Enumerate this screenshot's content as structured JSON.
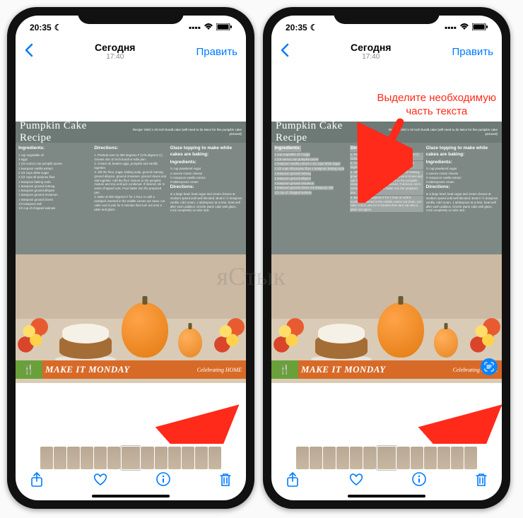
{
  "status": {
    "time": "20:35",
    "moon": "☾"
  },
  "nav": {
    "title": "Сегодня",
    "subtitle": "17:40",
    "edit": "Править"
  },
  "recipe": {
    "title": "Pumpkin Cake Recipe",
    "yield": "Recipe Yield 1-10 inch bundt cake\n(will need to do twice for the\npumpkin cake pictured)",
    "col1_title": "Ingredients:",
    "ingredients": [
      "1 cup vegetable oil",
      "3 eggs",
      "1 (15 ounce) can pumpkin puree",
      "1 teaspoon vanilla extract",
      "2 1/2 cups white sugar",
      "2 1/2 cups all-purpose flour",
      "1 teaspoon baking soda",
      "1 teaspoon ground nutmeg",
      "1 teaspoon ground allspice",
      "1 teaspoon ground cinnamon",
      "1 teaspoon ground cloves",
      "1/4 teaspoon salt",
      "1/2 cup of chopped walnuts"
    ],
    "col2_title": "Directions:",
    "directions": [
      "1. Preheat oven to 350 degrees F (175 degrees C). Grease one 10 inch bundt or tube pan.",
      "2. Cream oil, beaten eggs, pumpkin and vanilla together.",
      "3. Sift the flour, sugar, baking soda, ground nutmeg, ground allspice, ground cinnamon, ground cloves and salt together. Add the flour mixture to the pumpkin mixture and mix until just combined. If desired, stir in some chopped nuts. Pour batter into the prepared pan.",
      "4. Bake at 350 degrees F for 1 hour or until a toothpick inserted in the middle comes out clean. Let cake cool in pan for 5 minutes then turn out onto a plate and glaze."
    ],
    "col3_title": "Glaze topping to make while cakes are baking:",
    "col3_sub": "Ingredients:",
    "glaze_ing": [
      "½ cup powdered sugar",
      "4 ounces cream cheese",
      "½ teaspoon vanilla extract",
      "3 tablespoons cream"
    ],
    "col3_dir_title": "Directions:",
    "glaze_dir": "In a large bowl, beat sugar and cream cheese at medium speed until well blended. Beat in ½ teaspoon vanilla. Add cream, 1 tablespoon at a time, beat well after each addition. Drizzle warm cake with glaze. Cool completely on wire rack."
  },
  "banner": {
    "main": "MAKE IT MONDAY",
    "right": "Celebrating HOME"
  },
  "callout": {
    "line1": "Выделите необходимую",
    "line2": "часть текста"
  },
  "watermark": "яСтык"
}
